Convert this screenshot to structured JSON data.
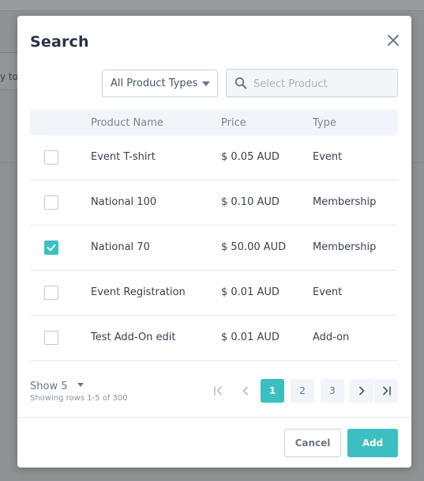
{
  "background": {
    "field_text": "y to"
  },
  "modal": {
    "title": "Search",
    "filters": {
      "type_select_value": "All Product Types",
      "search_placeholder": "Select Product",
      "search_value": ""
    },
    "table": {
      "headers": {
        "name": "Product Name",
        "price": "Price",
        "type": "Type"
      },
      "rows": [
        {
          "name": "Event T-shirt",
          "price": "$ 0.05 AUD",
          "type": "Event",
          "checked": false
        },
        {
          "name": "National 100",
          "price": "$ 0.10 AUD",
          "type": "Membership",
          "checked": false
        },
        {
          "name": "National 70",
          "price": "$ 50.00 AUD",
          "type": "Membership",
          "checked": true
        },
        {
          "name": "Event Registration",
          "price": "$ 0.01 AUD",
          "type": "Event",
          "checked": false
        },
        {
          "name": "Test Add-On edit",
          "price": "$ 0.01 AUD",
          "type": "Add-on",
          "checked": false
        }
      ]
    },
    "pagination": {
      "show_label": "Show 5",
      "rows_info": "Showing rows 1-5 of 300",
      "pages": [
        "1",
        "2",
        "3"
      ],
      "current_page": "1"
    },
    "buttons": {
      "cancel": "Cancel",
      "add": "Add"
    }
  },
  "colors": {
    "accent": "#3cbfc1",
    "title": "#2a3142",
    "muted": "#7a8594"
  }
}
